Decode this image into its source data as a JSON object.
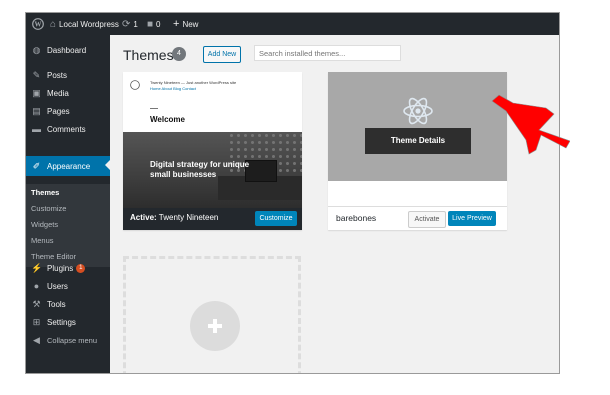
{
  "adminbar": {
    "site_name": "Local Wordpress",
    "updates_count": "1",
    "comments_count": "0",
    "new_label": "New"
  },
  "sidebar": {
    "items": [
      {
        "label": "Dashboard",
        "icon": "dashboard-icon"
      },
      {
        "label": "Posts",
        "icon": "pin-icon"
      },
      {
        "label": "Media",
        "icon": "media-icon"
      },
      {
        "label": "Pages",
        "icon": "pages-icon"
      },
      {
        "label": "Comments",
        "icon": "comment-icon"
      },
      {
        "label": "Appearance",
        "icon": "brush-icon"
      },
      {
        "label": "Plugins",
        "icon": "plug-icon",
        "badge": "1"
      },
      {
        "label": "Users",
        "icon": "user-icon"
      },
      {
        "label": "Tools",
        "icon": "wrench-icon"
      },
      {
        "label": "Settings",
        "icon": "settings-icon"
      },
      {
        "label": "Collapse menu",
        "icon": "collapse-icon"
      }
    ],
    "submenu": [
      "Themes",
      "Customize",
      "Widgets",
      "Menus",
      "Theme Editor"
    ]
  },
  "header": {
    "title": "Themes",
    "count": "4",
    "add_new": "Add New",
    "search_placeholder": "Search installed themes..."
  },
  "themes": [
    {
      "name": "Twenty Nineteen",
      "active_prefix": "Active:",
      "button": "Customize",
      "preview_site_title": "Twenty Nineteen — Just another WordPress site",
      "preview_nav": "Home  About  Blog  Contact",
      "preview_welcome": "Welcome",
      "preview_hero": "Digital strategy for unique small businesses"
    },
    {
      "name": "barebones",
      "details_button": "Theme Details",
      "activate_button": "Activate",
      "preview_button": "Live Preview"
    }
  ],
  "colors": {
    "admin_dark": "#23282d",
    "accent_blue": "#0073aa",
    "button_blue": "#0085ba",
    "arrow_red": "#ff0000"
  }
}
